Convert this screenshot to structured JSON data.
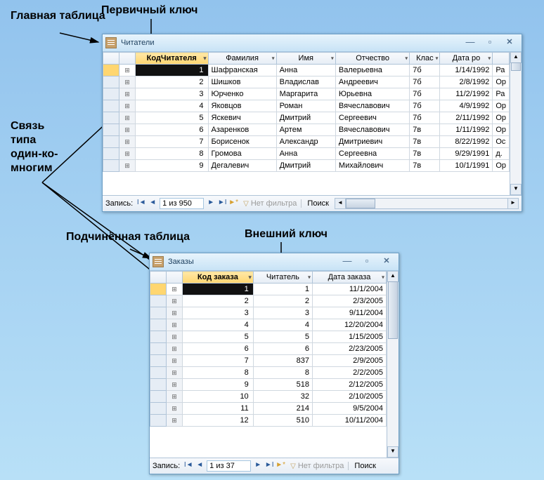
{
  "labels": {
    "main_table": "Главная таблица",
    "primary_key": "Первичный ключ",
    "rel": "Связь типа один-ко-многим",
    "sub_table": "Подчинённая таблица",
    "foreign_key": "Внешний ключ"
  },
  "win1": {
    "title": "Читатели",
    "cols": [
      "КодЧитателя",
      "Фамилия",
      "Имя",
      "Отчество",
      "Клас",
      "Дата ро"
    ],
    "rows": [
      {
        "id": "1",
        "f": "Шафранская",
        "n": "Анна",
        "p": "Валерьевна",
        "k": "7б",
        "d": "1/14/1992",
        "z": "Ра"
      },
      {
        "id": "2",
        "f": "Шишков",
        "n": "Владислав",
        "p": "Андреевич",
        "k": "7б",
        "d": "2/8/1992",
        "z": "Ор"
      },
      {
        "id": "3",
        "f": "Юрченко",
        "n": "Маргарита",
        "p": "Юрьевна",
        "k": "7б",
        "d": "11/2/1992",
        "z": "Ра"
      },
      {
        "id": "4",
        "f": "Яковцов",
        "n": "Роман",
        "p": "Вячеславович",
        "k": "7б",
        "d": "4/9/1992",
        "z": "Ор"
      },
      {
        "id": "5",
        "f": "Яскевич",
        "n": "Дмитрий",
        "p": "Сергеевич",
        "k": "7б",
        "d": "2/11/1992",
        "z": "Ор"
      },
      {
        "id": "6",
        "f": "Азаренков",
        "n": "Артем",
        "p": "Вячеславович",
        "k": "7в",
        "d": "1/11/1992",
        "z": "Ор"
      },
      {
        "id": "7",
        "f": "Борисенок",
        "n": "Александр",
        "p": "Дмитриевич",
        "k": "7в",
        "d": "8/22/1992",
        "z": "Ос"
      },
      {
        "id": "8",
        "f": "Громова",
        "n": "Анна",
        "p": "Сергеевна",
        "k": "7в",
        "d": "9/29/1991",
        "z": "д."
      },
      {
        "id": "9",
        "f": "Дегалевич",
        "n": "Дмитрий",
        "p": "Михайлович",
        "k": "7в",
        "d": "10/1/1991",
        "z": "Ор"
      }
    ],
    "nav": {
      "label": "Запись:",
      "rec": "1 из 950",
      "filter": "Нет фильтра",
      "search": "Поиск"
    }
  },
  "win2": {
    "title": "Заказы",
    "cols": [
      "Код заказа",
      "Читатель",
      "Дата заказа"
    ],
    "rows": [
      {
        "id": "1",
        "r": "1",
        "d": "11/1/2004"
      },
      {
        "id": "2",
        "r": "2",
        "d": "2/3/2005"
      },
      {
        "id": "3",
        "r": "3",
        "d": "9/11/2004"
      },
      {
        "id": "4",
        "r": "4",
        "d": "12/20/2004"
      },
      {
        "id": "5",
        "r": "5",
        "d": "1/15/2005"
      },
      {
        "id": "6",
        "r": "6",
        "d": "2/23/2005"
      },
      {
        "id": "7",
        "r": "837",
        "d": "2/9/2005"
      },
      {
        "id": "8",
        "r": "8",
        "d": "2/2/2005"
      },
      {
        "id": "9",
        "r": "518",
        "d": "2/12/2005"
      },
      {
        "id": "10",
        "r": "32",
        "d": "2/10/2005"
      },
      {
        "id": "11",
        "r": "214",
        "d": "9/5/2004"
      },
      {
        "id": "12",
        "r": "510",
        "d": "10/11/2004"
      }
    ],
    "nav": {
      "label": "Запись:",
      "rec": "1 из 37",
      "filter": "Нет фильтра",
      "search": "Поиск"
    }
  }
}
